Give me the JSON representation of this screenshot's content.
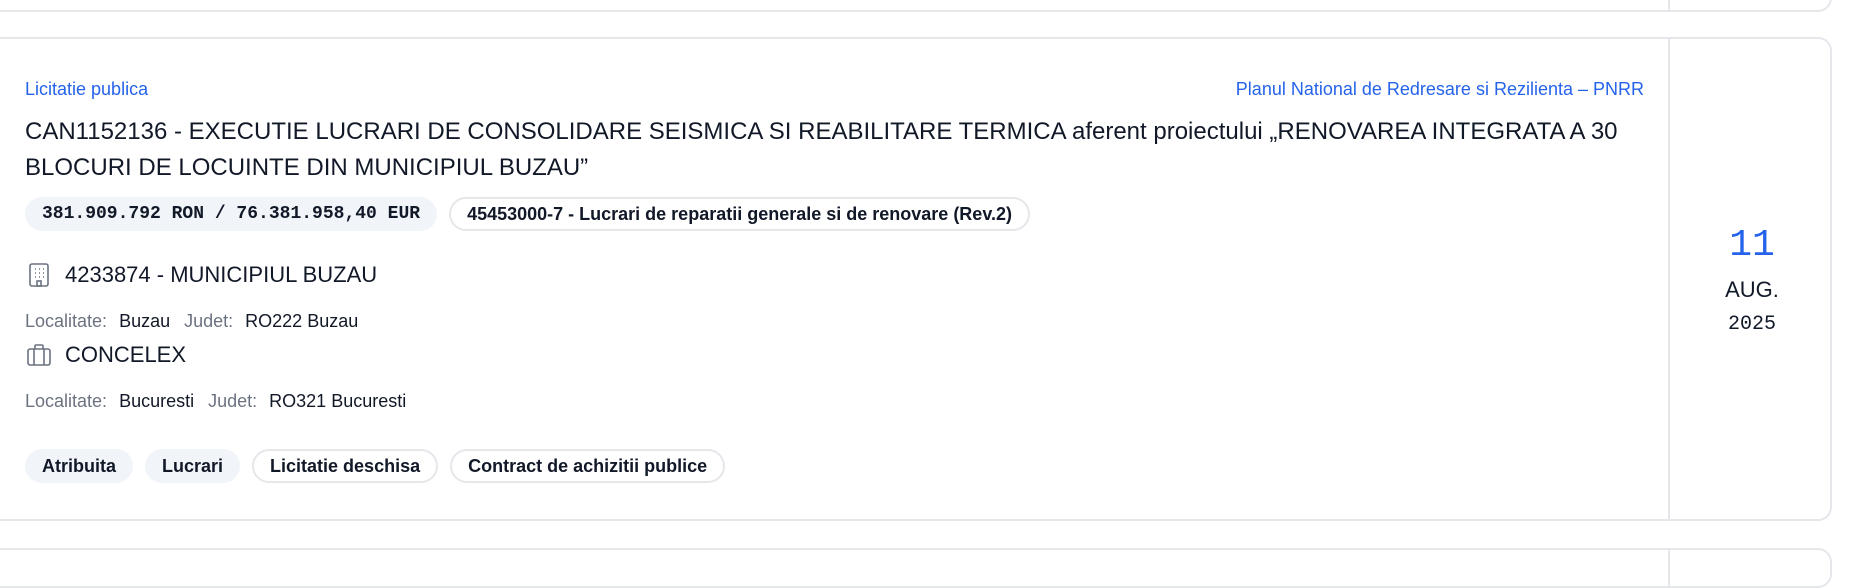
{
  "listing": {
    "procedure_type": "Licitatie publica",
    "program": "Planul National de Redresare si Rezilienta – PNRR",
    "title": "CAN1152136 - EXECUTIE LUCRARI DE CONSOLIDARE SEISMICA SI REABILITARE TERMICA aferent proiectului „RENOVAREA INTEGRATA A 30 BLOCURI DE LOCUINTE DIN MUNICIPIUL BUZAU”",
    "value_chip": "381.909.792 RON / 76.381.958,40 EUR",
    "cpv_chip": "45453000-7 - Lucrari de reparatii generale si de renovare (Rev.2)",
    "authority": {
      "icon": "building-icon",
      "name": "4233874 - MUNICIPIUL BUZAU",
      "locality_label": "Localitate:",
      "locality": "Buzau",
      "county_label": "Judet:",
      "county": "RO222 Buzau"
    },
    "contractor": {
      "icon": "briefcase-icon",
      "name": "CONCELEX",
      "locality_label": "Localitate:",
      "locality": "Bucuresti",
      "county_label": "Judet:",
      "county": "RO321 Bucuresti"
    },
    "tags": [
      "Atribuita",
      "Lucrari",
      "Licitatie deschisa",
      "Contract de achizitii publice"
    ],
    "date": {
      "day": "11",
      "month": "AUG.",
      "year": "2025"
    }
  },
  "colors": {
    "accent": "#2563eb",
    "border": "#e5e7eb",
    "chip_fill": "#f1f5f9",
    "muted": "#6b7280"
  }
}
